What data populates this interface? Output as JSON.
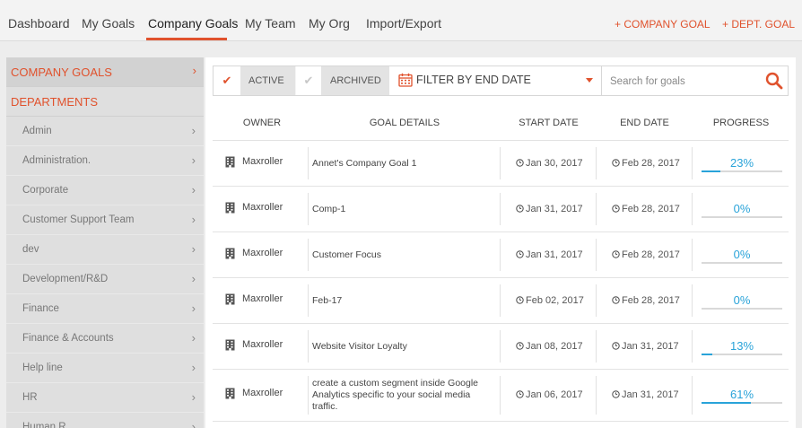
{
  "nav": {
    "tabs": [
      "Dashboard",
      "My Goals",
      "Company Goals",
      "My Team",
      "My Org",
      "Import/Export"
    ],
    "active_tab": "Company Goals",
    "add_company_goal": "+ COMPANY GOAL",
    "add_dept_goal": "+ DEPT. GOAL"
  },
  "sidebar": {
    "company_goals_label": "COMPANY GOALS",
    "departments_label": "DEPARTMENTS",
    "departments": [
      "Admin",
      "Administration.",
      "Corporate",
      "Customer Support Team",
      "dev",
      "Development/R&D",
      "Finance",
      "Finance & Accounts",
      "Help line",
      "HR",
      "Human R..."
    ]
  },
  "filters": {
    "active_label": "ACTIVE",
    "archived_label": "ARCHIVED",
    "date_filter_label": "FILTER BY END DATE",
    "search_placeholder": "Search for goals"
  },
  "table": {
    "headers": {
      "owner": "OWNER",
      "goal_details": "GOAL DETAILS",
      "start_date": "START DATE",
      "end_date": "END DATE",
      "progress": "PROGRESS"
    },
    "rows": [
      {
        "owner": "Maxroller",
        "goal": "Annet's Company Goal 1",
        "start": "Jan 30, 2017",
        "end": "Feb 28, 2017",
        "progress_label": "23%",
        "progress": 23
      },
      {
        "owner": "Maxroller",
        "goal": "Comp-1",
        "start": "Jan 31, 2017",
        "end": "Feb 28, 2017",
        "progress_label": "0%",
        "progress": 0
      },
      {
        "owner": "Maxroller",
        "goal": "Customer Focus",
        "start": "Jan 31, 2017",
        "end": "Feb 28, 2017",
        "progress_label": "0%",
        "progress": 0
      },
      {
        "owner": "Maxroller",
        "goal": "Feb-17",
        "start": "Feb 02, 2017",
        "end": "Feb 28, 2017",
        "progress_label": "0%",
        "progress": 0
      },
      {
        "owner": "Maxroller",
        "goal": "Website Visitor Loyalty",
        "start": "Jan 08, 2017",
        "end": "Jan 31, 2017",
        "progress_label": "13%",
        "progress": 13
      },
      {
        "owner": "Maxroller",
        "goal": "create a custom segment inside Google Analytics specific to your social media traffic.",
        "start": "Jan 06, 2017",
        "end": "Jan 31, 2017",
        "progress_label": "61%",
        "progress": 61
      }
    ]
  },
  "colors": {
    "accent": "#e0522d",
    "progress": "#29a3d9"
  }
}
